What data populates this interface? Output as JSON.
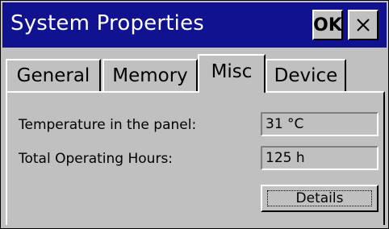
{
  "window": {
    "title": "System Properties",
    "ok_label": "OK",
    "close_icon": "close-icon",
    "colors": {
      "titlebar": "#10128f",
      "face": "#c0c0c0"
    }
  },
  "tabs": [
    {
      "label": "General",
      "active": false
    },
    {
      "label": "Memory",
      "active": false
    },
    {
      "label": "Misc",
      "active": true
    },
    {
      "label": "Device",
      "active": false
    }
  ],
  "misc": {
    "temperature": {
      "label": "Temperature in the panel:",
      "value": "31 °C"
    },
    "hours": {
      "label": "Total Operating Hours:",
      "value": "125 h"
    },
    "details_label": "Details"
  }
}
